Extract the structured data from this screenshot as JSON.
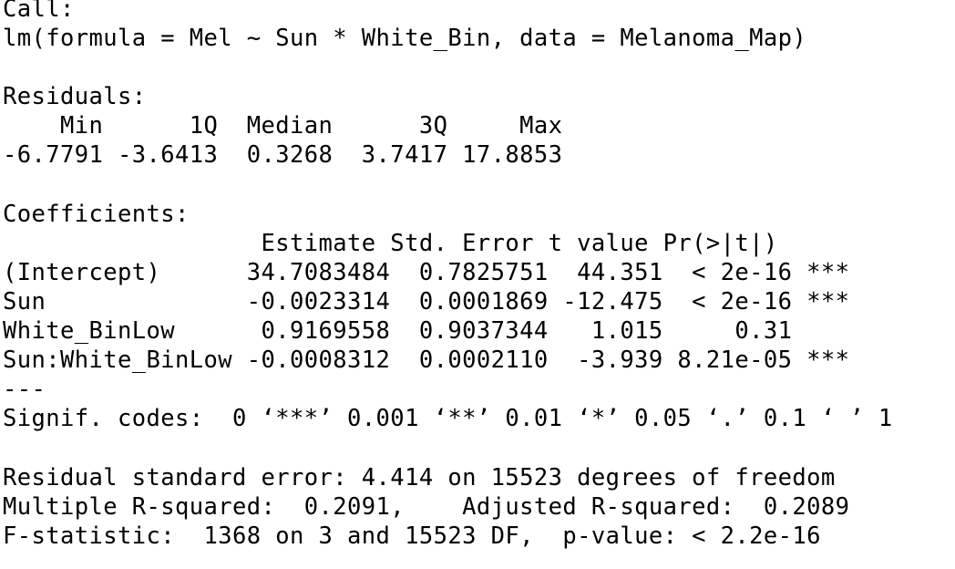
{
  "console": {
    "lines": [
      "Call:",
      "lm(formula = Mel ~ Sun * White_Bin, data = Melanoma_Map)",
      "",
      "Residuals:",
      "    Min      1Q  Median      3Q     Max ",
      "-6.7791 -3.6413  0.3268  3.7417 17.8853 ",
      "",
      "Coefficients:",
      "                  Estimate Std. Error t value Pr(>|t|)    ",
      "(Intercept)      34.7083484  0.7825751  44.351  < 2e-16 ***",
      "Sun              -0.0023314  0.0001869 -12.475  < 2e-16 ***",
      "White_BinLow      0.9169558  0.9037344   1.015     0.31    ",
      "Sun:White_BinLow -0.0008312  0.0002110  -3.939 8.21e-05 ***",
      "---",
      "Signif. codes:  0 ‘***’ 0.001 ‘**’ 0.01 ‘*’ 0.05 ‘.’ 0.1 ‘ ’ 1",
      "",
      "Residual standard error: 4.414 on 15523 degrees of freedom",
      "Multiple R-squared:  0.2091,\tAdjusted R-squared:  0.2089 ",
      "F-statistic:  1368 on 3 and 15523 DF,  p-value: < 2.2e-16"
    ]
  }
}
